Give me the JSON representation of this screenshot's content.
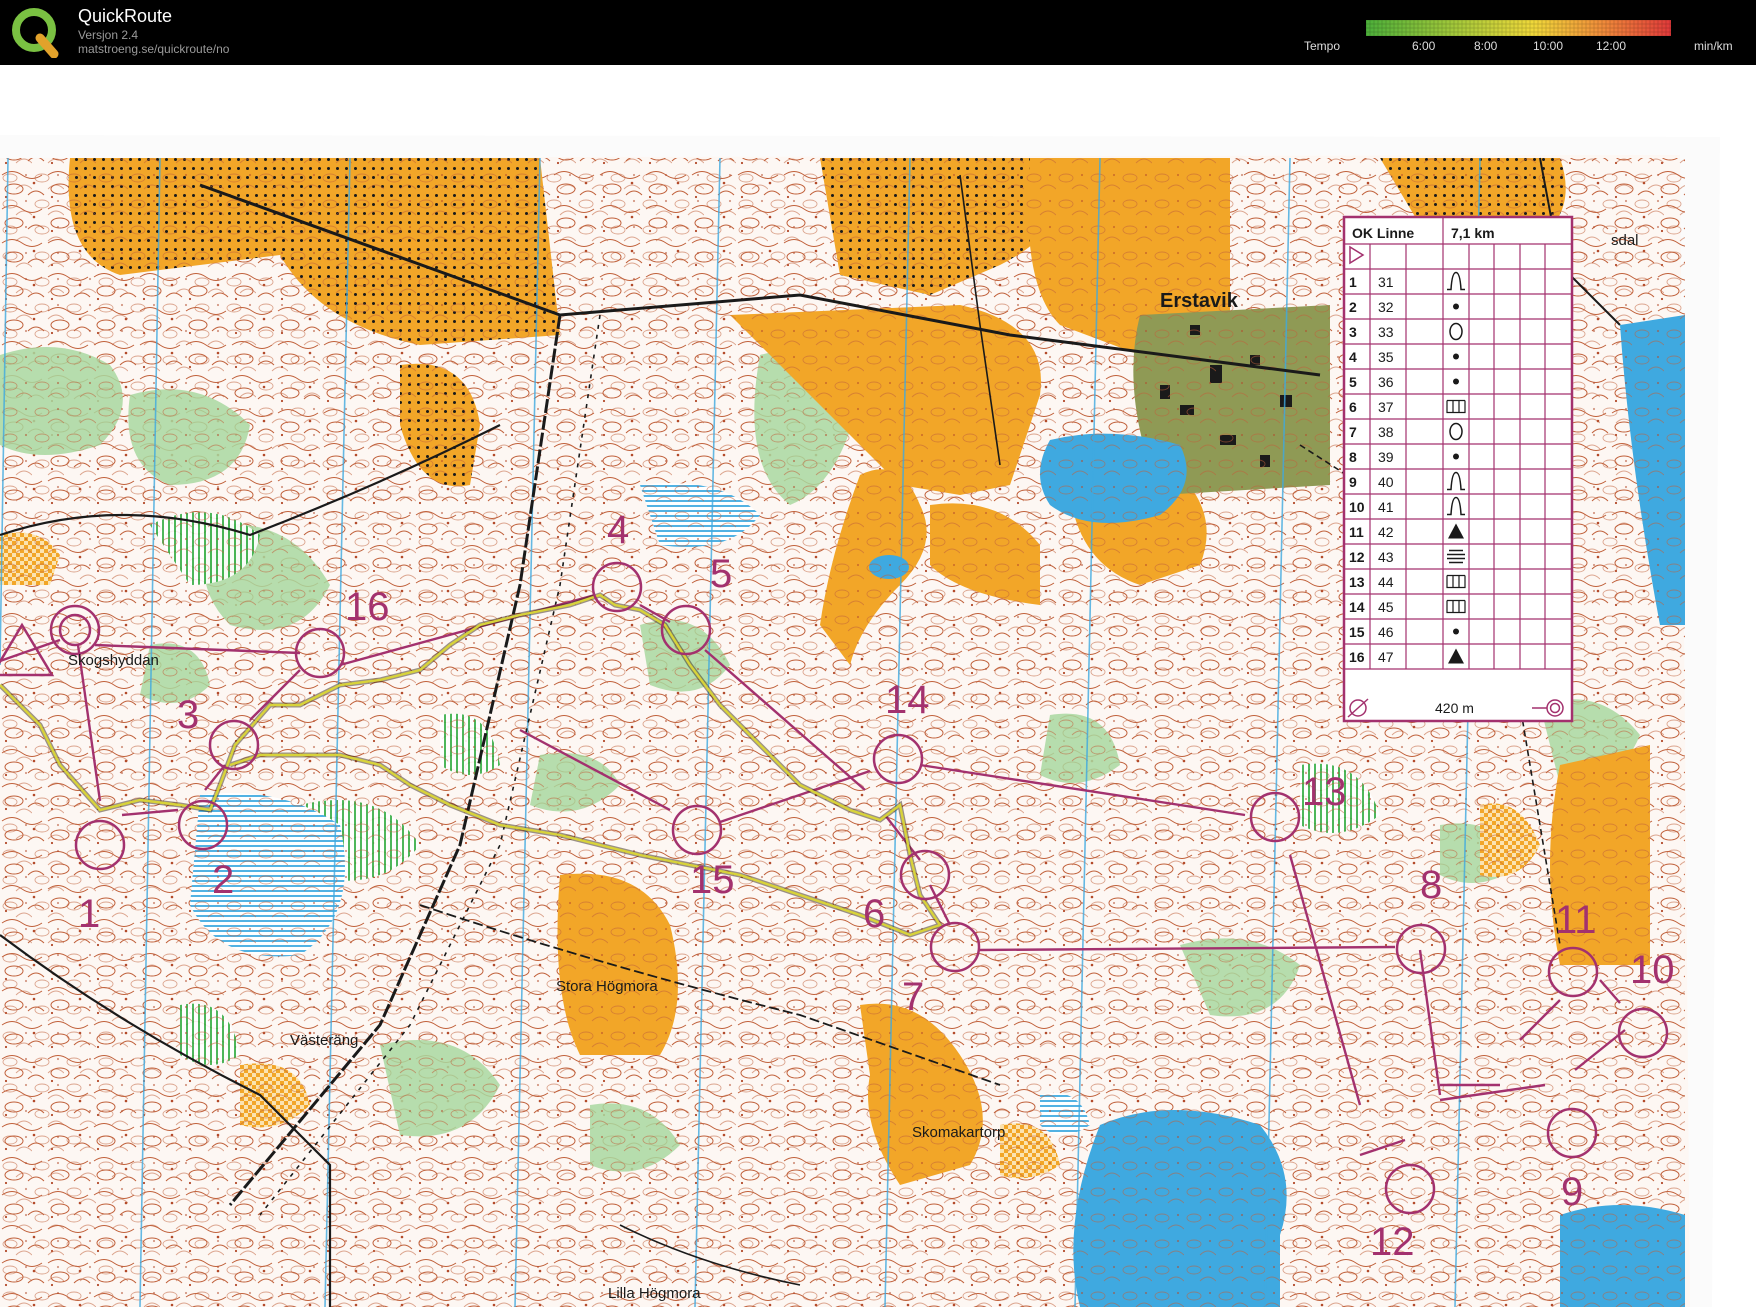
{
  "app": {
    "title": "QuickRoute",
    "version": "Versjon 2.4",
    "url": "matstroeng.se/quickroute/no"
  },
  "tempo": {
    "label": "Tempo",
    "ticks": [
      "6:00",
      "8:00",
      "10:00",
      "12:00"
    ],
    "unit": "min/km",
    "colors": [
      "#4caf3a",
      "#a6c93a",
      "#f0d83a",
      "#f08a3a",
      "#e0393a"
    ]
  },
  "map": {
    "colors": {
      "field": "#f2a628",
      "water": "#3fa9e0",
      "forest_green": "#86c98a",
      "contour": "#b34a2a",
      "course": "#a3316e",
      "route": "#c8c628"
    },
    "places": {
      "skogshyddan": "Skogshyddan",
      "erstavik": "Erstavik",
      "stora_hogmora": "Stora Högmora",
      "vasterang": "Västeräng",
      "skomakartorp": "Skomakartorp",
      "lilla_hogmora": "Lilla Högmora",
      "sdal": "sdal"
    },
    "controls": [
      "1",
      "2",
      "3",
      "4",
      "5",
      "6",
      "7",
      "8",
      "9",
      "10",
      "11",
      "12",
      "13",
      "14",
      "15",
      "16"
    ]
  },
  "description": {
    "club": "OK Linne",
    "length": "7,1 km",
    "rows": [
      {
        "num": "1",
        "code": "31",
        "sym": "re-entrant"
      },
      {
        "num": "2",
        "code": "32",
        "sym": "dot"
      },
      {
        "num": "3",
        "code": "33",
        "sym": "ellipse"
      },
      {
        "num": "4",
        "code": "35",
        "sym": "dot"
      },
      {
        "num": "5",
        "code": "36",
        "sym": "dot"
      },
      {
        "num": "6",
        "code": "37",
        "sym": "comb"
      },
      {
        "num": "7",
        "code": "38",
        "sym": "ellipse"
      },
      {
        "num": "8",
        "code": "39",
        "sym": "dot"
      },
      {
        "num": "9",
        "code": "40",
        "sym": "re-entrant"
      },
      {
        "num": "10",
        "code": "41",
        "sym": "re-entrant"
      },
      {
        "num": "11",
        "code": "42",
        "sym": "triangle"
      },
      {
        "num": "12",
        "code": "43",
        "sym": "hatched"
      },
      {
        "num": "13",
        "code": "44",
        "sym": "comb"
      },
      {
        "num": "14",
        "code": "45",
        "sym": "comb"
      },
      {
        "num": "15",
        "code": "46",
        "sym": "dot"
      },
      {
        "num": "16",
        "code": "47",
        "sym": "triangle"
      }
    ],
    "finish": "420 m"
  }
}
